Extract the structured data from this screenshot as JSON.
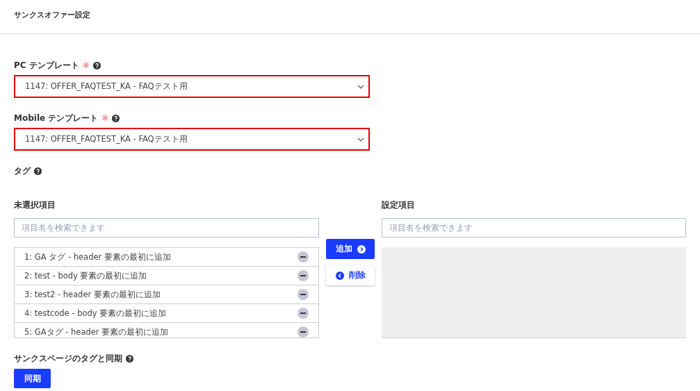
{
  "page_title": "サンクスオファー設定",
  "templates": [
    {
      "label": "PC テンプレート",
      "required_mark": "※",
      "value": "1147: OFFER_FAQTEST_KA - FAQテスト用"
    },
    {
      "label": "Mobile テンプレート",
      "required_mark": "※",
      "value": "1147: OFFER_FAQTEST_KA - FAQテスト用"
    }
  ],
  "tag_label": "タグ",
  "unselected": {
    "label": "未選択項目",
    "placeholder": "項目名を検索できます",
    "items": [
      {
        "text": "1: GA タグ - header 要素の最初に追加"
      },
      {
        "text": "2: test - body 要素の最初に追加"
      },
      {
        "text": "3: test2 - header 要素の最初に追加"
      },
      {
        "text": "4: testcode - body 要素の最初に追加"
      },
      {
        "text": "5: GAタグ - header 要素の最初に追加"
      }
    ]
  },
  "add_button": "追加",
  "remove_button": "削除",
  "selected": {
    "label": "設定項目",
    "placeholder": "項目名を検索できます"
  },
  "sync": {
    "label": "サンクスページのタグと同期",
    "button": "同期"
  }
}
